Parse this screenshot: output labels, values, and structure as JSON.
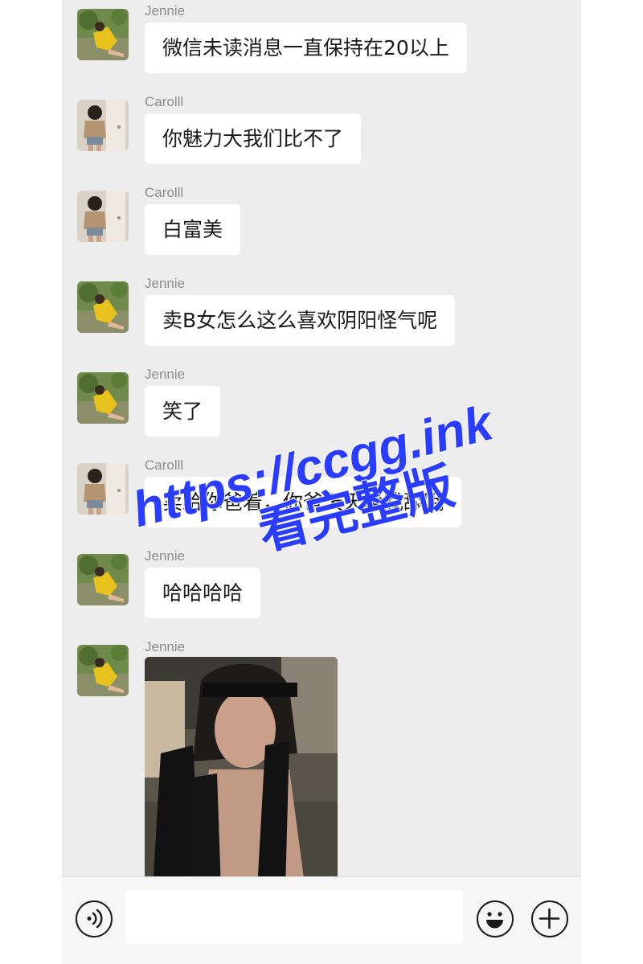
{
  "messages": [
    {
      "sender": "Jennie",
      "avatar": "jennie-avatar",
      "text": "微信未读消息一直保持在20以上"
    },
    {
      "sender": "Carolll",
      "avatar": "carolll-avatar",
      "text": "你魅力大我们比不了"
    },
    {
      "sender": "Carolll",
      "avatar": "carolll-avatar",
      "text": "白富美"
    },
    {
      "sender": "Jennie",
      "avatar": "jennie-avatar",
      "text": "卖B女怎么这么喜欢阴阳怪气呢"
    },
    {
      "sender": "Jennie",
      "avatar": "jennie-avatar",
      "text": "笑了"
    },
    {
      "sender": "Carolll",
      "avatar": "carolll-avatar",
      "text": "卖给你爸着，你爸天天帮我舔哦"
    },
    {
      "sender": "Jennie",
      "avatar": "jennie-avatar",
      "text": "哈哈哈哈"
    },
    {
      "sender": "Jennie",
      "avatar": "jennie-avatar",
      "image": "photo-message-redacted"
    }
  ],
  "watermark": {
    "line1": "https://ccgg.ink",
    "line2": "看完整版",
    "color": "#2a3cff"
  },
  "input_bar": {
    "voice_icon": "voice-icon",
    "emoji_icon": "emoji-icon",
    "plus_icon": "plus-icon",
    "placeholder": ""
  },
  "colors": {
    "background": "#ededed",
    "bubble": "#ffffff",
    "sender_name": "#8c8c8c",
    "input_bar": "#f6f6f6"
  }
}
